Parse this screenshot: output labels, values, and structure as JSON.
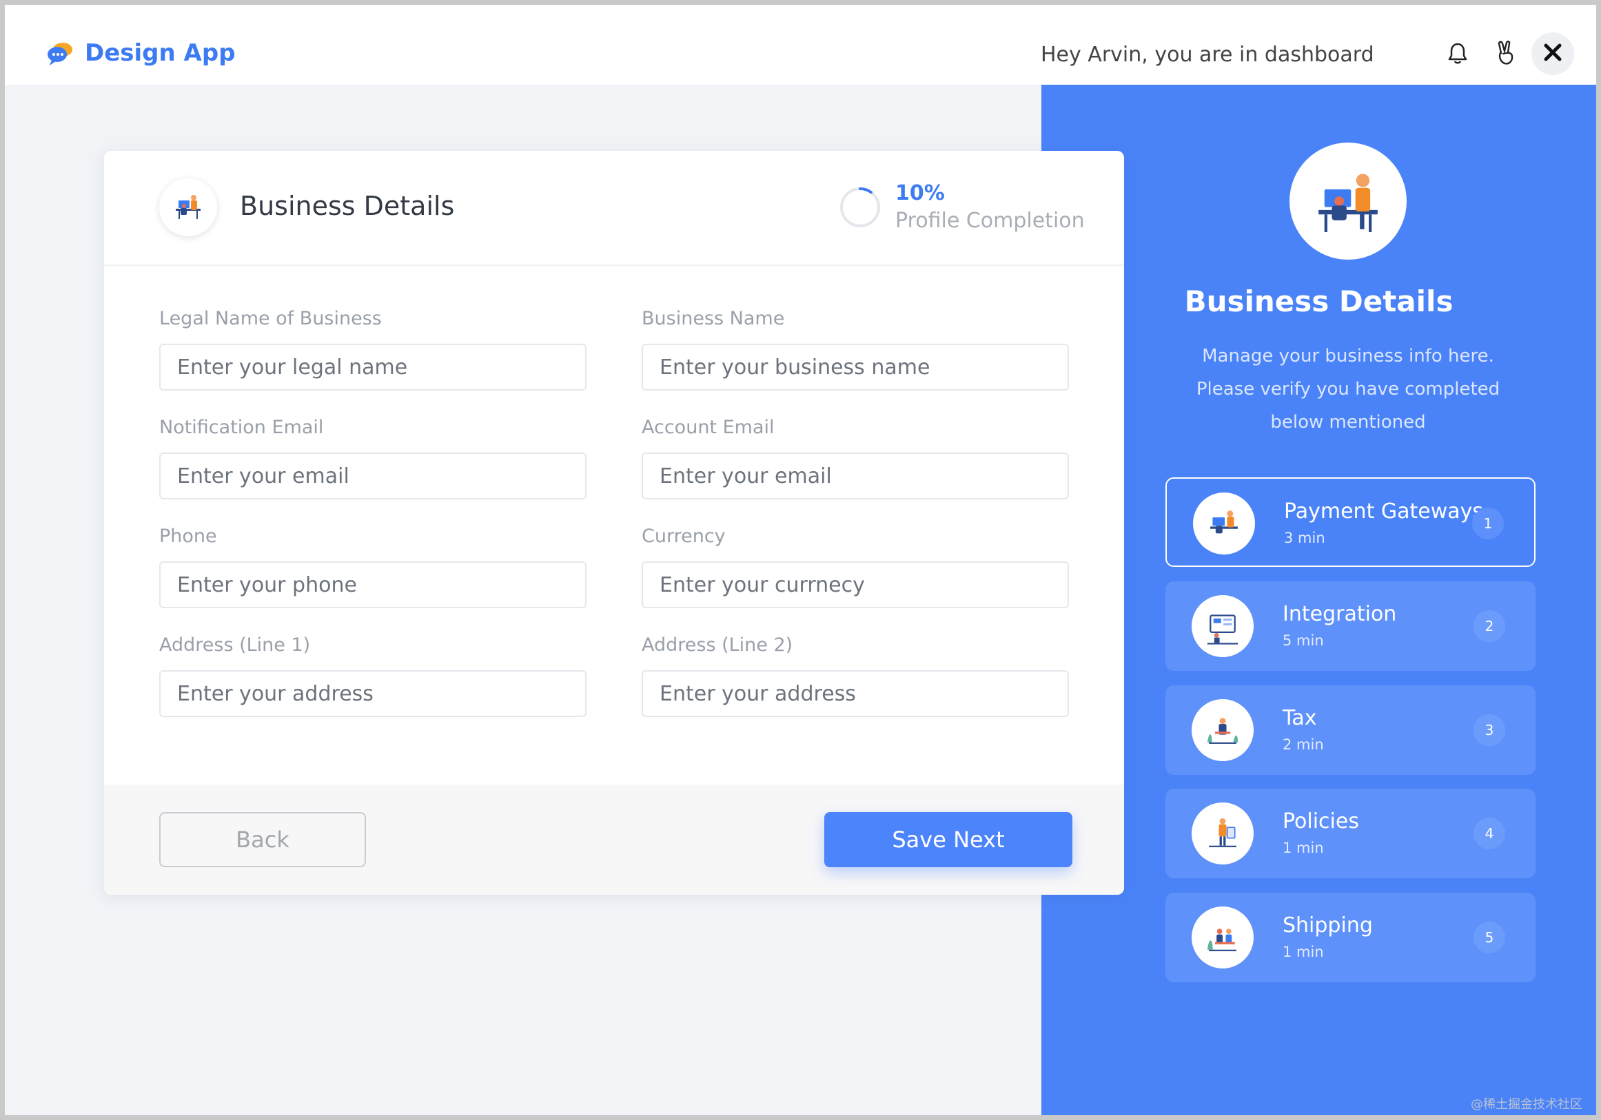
{
  "app": {
    "name": "Design App",
    "brand_color": "#3d7bf2"
  },
  "header": {
    "greeting": "Hey Arvin, you are in dashboard",
    "icons": [
      "bell-icon",
      "peace-hand-icon",
      "close-icon"
    ]
  },
  "form": {
    "title": "Business Details",
    "progress_percent": "10%",
    "progress_value": 0.1,
    "progress_label": "Profile Completion",
    "fields": {
      "legal_name": {
        "label": "Legal Name of Business",
        "placeholder": "Enter your legal name"
      },
      "business_name": {
        "label": "Business Name",
        "placeholder": "Enter your business name"
      },
      "notification_email": {
        "label": "Notification Email",
        "placeholder": "Enter your email"
      },
      "account_email": {
        "label": "Account Email",
        "placeholder": "Enter your email"
      },
      "phone": {
        "label": "Phone",
        "placeholder": "Enter your phone"
      },
      "currency": {
        "label": "Currency",
        "placeholder": "Enter your currnecy"
      },
      "address1": {
        "label": "Address (Line 1)",
        "placeholder": "Enter your address"
      },
      "address2": {
        "label": "Address (Line 2)",
        "placeholder": "Enter your address"
      }
    },
    "back_label": "Back",
    "save_label": "Save Next"
  },
  "panel": {
    "title": "Business Details",
    "description": "Manage your business info here. Please verify you have completed below mentioned",
    "accent_color": "#4a83f8",
    "steps": [
      {
        "name": "Payment Gateways",
        "time": "3 min",
        "number": "1",
        "active": true
      },
      {
        "name": "Integration",
        "time": "5 min",
        "number": "2",
        "active": false
      },
      {
        "name": "Tax",
        "time": "2 min",
        "number": "3",
        "active": false
      },
      {
        "name": "Policies",
        "time": "1 min",
        "number": "4",
        "active": false
      },
      {
        "name": "Shipping",
        "time": "1 min",
        "number": "5",
        "active": false
      }
    ]
  },
  "watermark": "@稀土掘金技术社区"
}
